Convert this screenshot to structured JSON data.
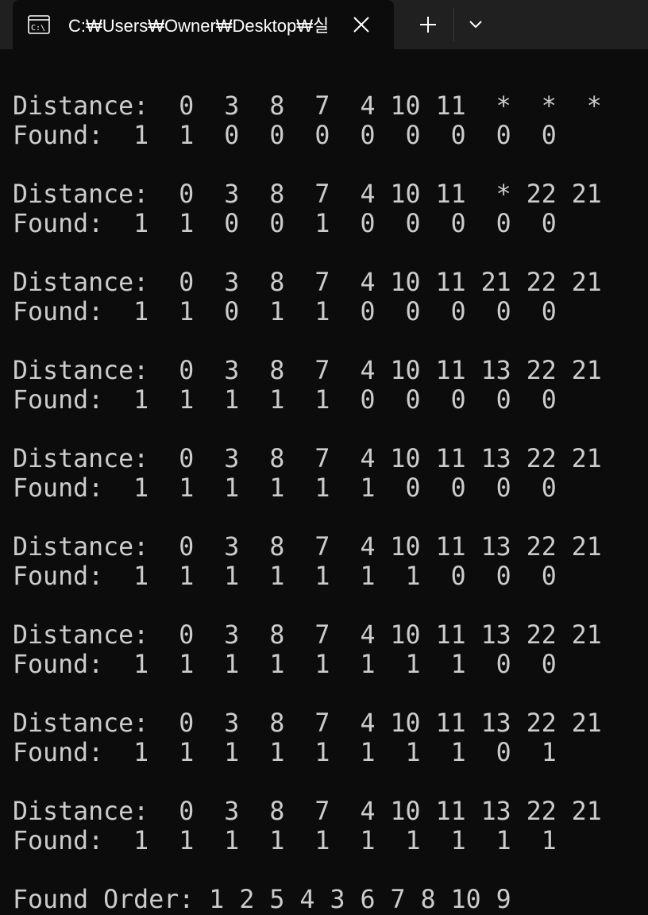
{
  "tab": {
    "title": "C:₩Users₩Owner₩Desktop₩실",
    "icon": "terminal-cmd-icon"
  },
  "toolbar": {
    "new_tab_icon": "plus-icon",
    "dropdown_icon": "chevron-down-icon"
  },
  "console": {
    "lines": [
      "Distance:  0  3  8  7  4 10 11  *  *  *",
      "Found:  1  1  0  0  0  0  0  0  0  0",
      "",
      "Distance:  0  3  8  7  4 10 11  * 22 21",
      "Found:  1  1  0  0  1  0  0  0  0  0",
      "",
      "Distance:  0  3  8  7  4 10 11 21 22 21",
      "Found:  1  1  0  1  1  0  0  0  0  0",
      "",
      "Distance:  0  3  8  7  4 10 11 13 22 21",
      "Found:  1  1  1  1  1  0  0  0  0  0",
      "",
      "Distance:  0  3  8  7  4 10 11 13 22 21",
      "Found:  1  1  1  1  1  1  0  0  0  0",
      "",
      "Distance:  0  3  8  7  4 10 11 13 22 21",
      "Found:  1  1  1  1  1  1  1  0  0  0",
      "",
      "Distance:  0  3  8  7  4 10 11 13 22 21",
      "Found:  1  1  1  1  1  1  1  1  0  0",
      "",
      "Distance:  0  3  8  7  4 10 11 13 22 21",
      "Found:  1  1  1  1  1  1  1  1  0  1",
      "",
      "Distance:  0  3  8  7  4 10 11 13 22 21",
      "Found:  1  1  1  1  1  1  1  1  1  1",
      "",
      "Found Order: 1 2 5 4 3 6 7 8 10 9"
    ]
  }
}
